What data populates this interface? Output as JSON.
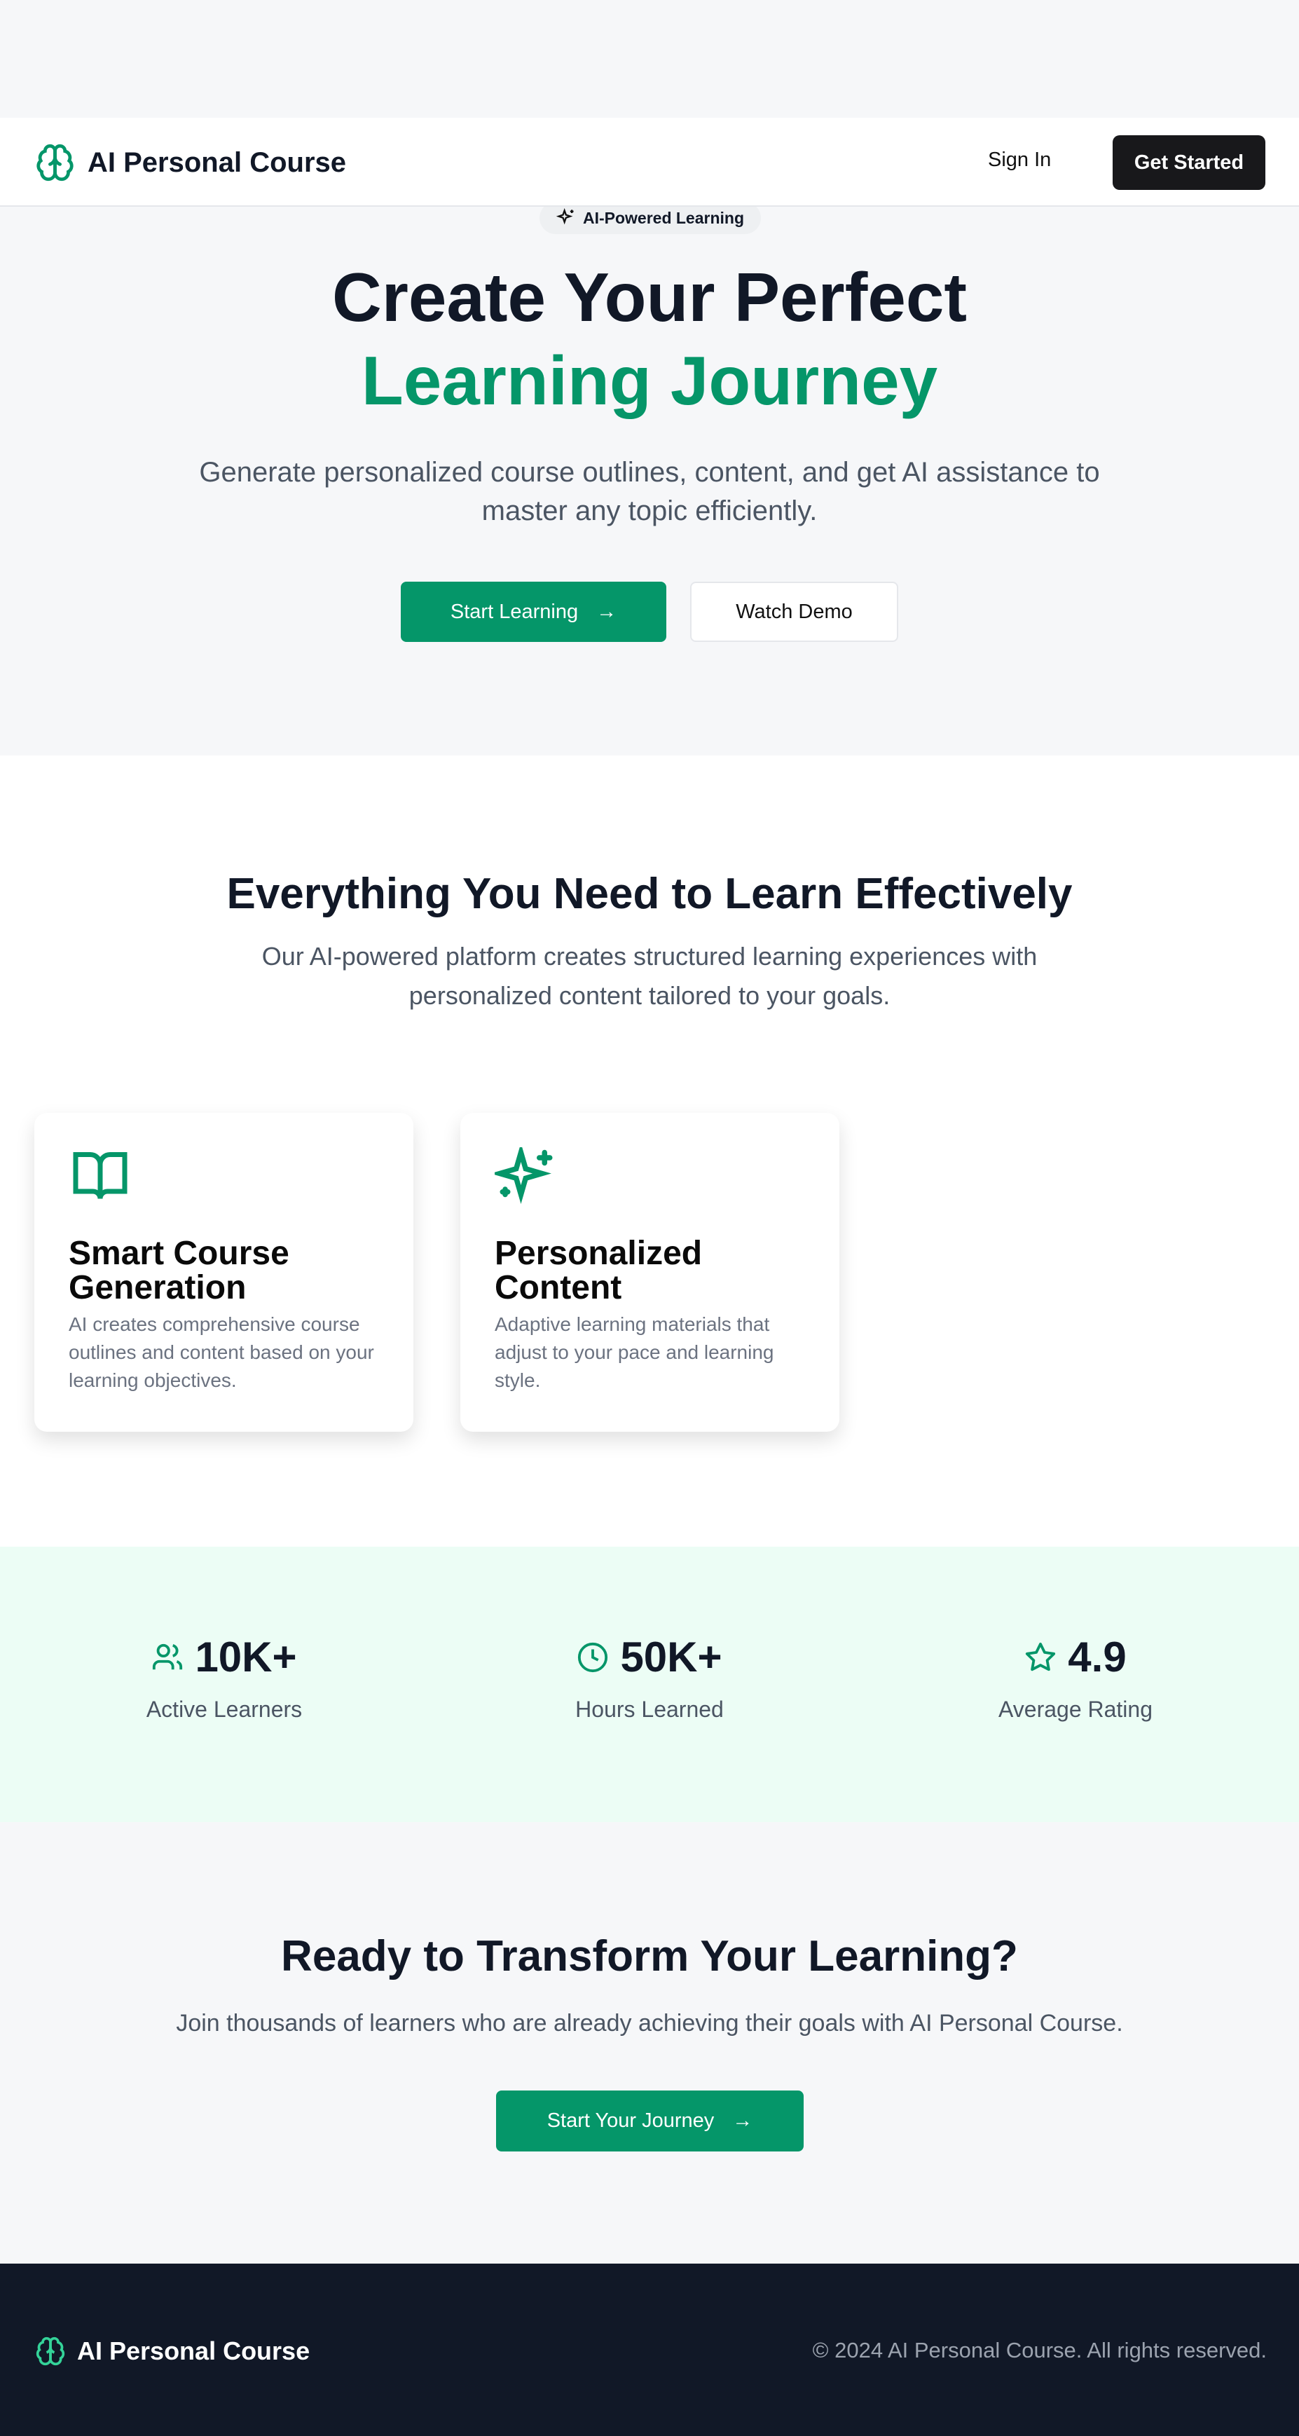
{
  "nav": {
    "brand": "AI Personal Course",
    "sign_in": "Sign In",
    "get_started": "Get Started"
  },
  "hero": {
    "badge": "AI-Powered Learning",
    "title_line1": "Create Your Perfect",
    "title_line2": "Learning Journey",
    "subtitle_line1": "Generate personalized course outlines, content, and get AI assistance to",
    "subtitle_line2": "master any topic efficiently.",
    "primary_button": "Start Learning",
    "secondary_button": "Watch Demo"
  },
  "features": {
    "heading": "Everything You Need to Learn Effectively",
    "desc_line1": "Our AI-powered platform creates structured learning experiences with",
    "desc_line2": "personalized content tailored to your goals.",
    "cards": [
      {
        "icon": "book-open-icon",
        "title": "Smart Course Generation",
        "desc": "AI creates comprehensive course outlines and content based on your learning objectives."
      },
      {
        "icon": "sparkles-icon",
        "title": "Personalized Content",
        "desc": "Adaptive learning materials that adjust to your pace and learning style."
      }
    ]
  },
  "stats": [
    {
      "icon": "users-icon",
      "value": "10K+",
      "label": "Active Learners"
    },
    {
      "icon": "clock-icon",
      "value": "50K+",
      "label": "Hours Learned"
    },
    {
      "icon": "star-icon",
      "value": "4.9",
      "label": "Average Rating"
    }
  ],
  "cta": {
    "heading": "Ready to Transform Your Learning?",
    "desc": "Join thousands of learners who are already achieving their goals with AI Personal Course.",
    "button": "Start Your Journey"
  },
  "footer": {
    "brand": "AI Personal Course",
    "copyright": "© 2024 AI Personal Course. All rights reserved."
  },
  "colors": {
    "accent": "#059669",
    "dark": "#111827",
    "stats_bg": "#ecfdf5"
  }
}
